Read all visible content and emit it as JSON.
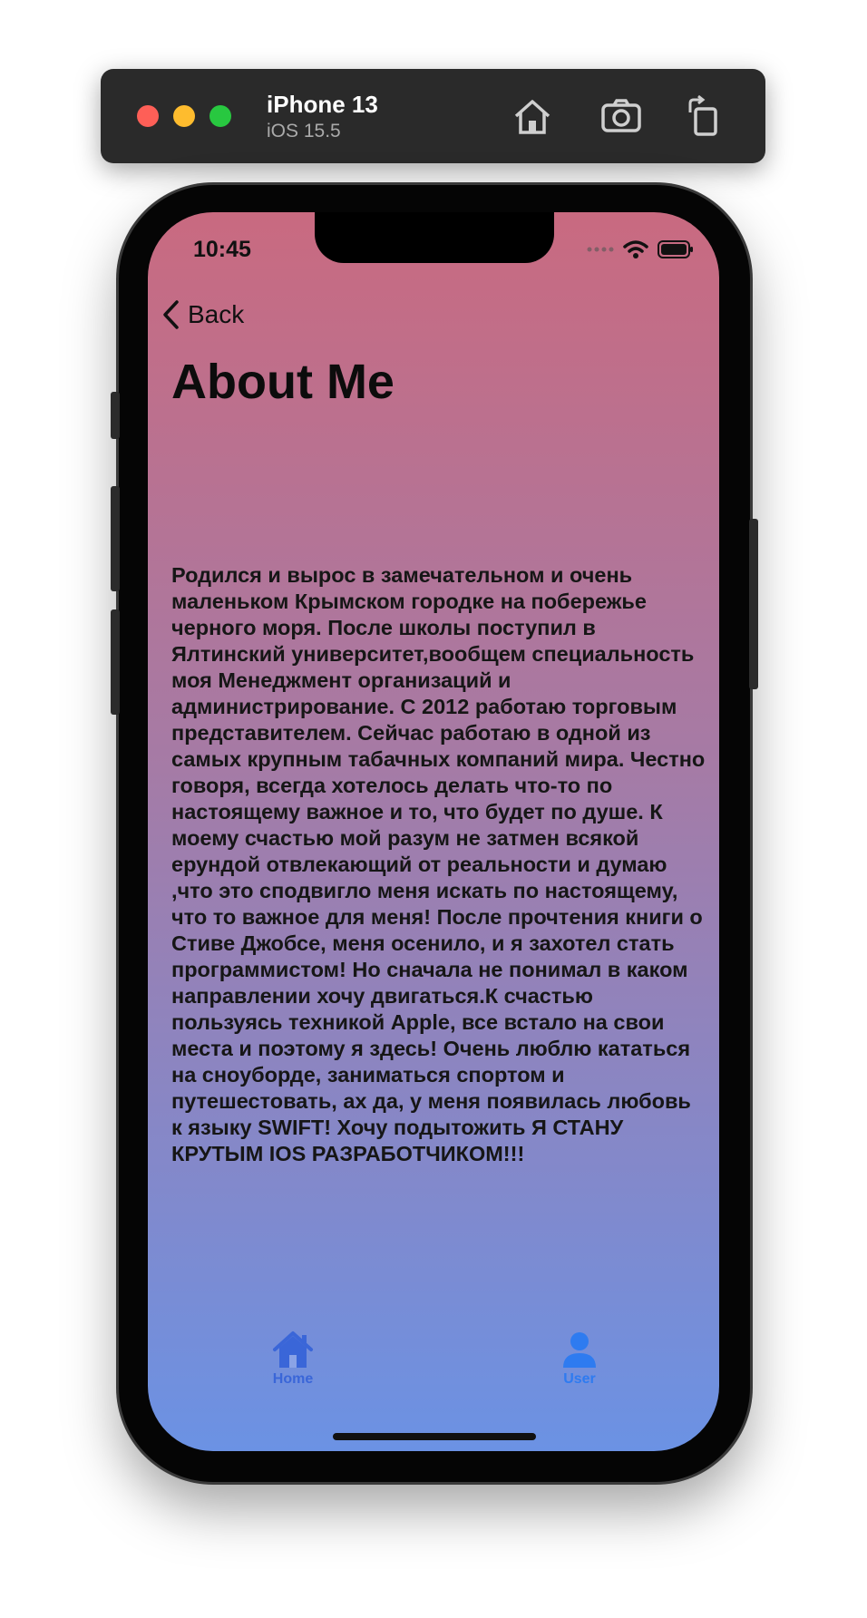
{
  "simulator": {
    "device_name": "iPhone 13",
    "os_version": "iOS 15.5",
    "buttons": [
      "home-icon",
      "screenshot-icon",
      "rotate-icon"
    ]
  },
  "status_bar": {
    "time": "10:45"
  },
  "nav": {
    "back_label": "Back"
  },
  "page": {
    "title": "About Me",
    "body": "Родился и вырос в замечательном и очень маленьком Крымском городке на побережье черного моря. После школы поступил в Ялтинский университет,вообщем специальность моя Менеджмент организаций и администрирование. С 2012 работаю торговым представителем. Сейчас работаю в одной из самых крупным табачных компаний мира. Честно говоря, всегда хотелось делать что-то по настоящему важное и то, что будет по душе. К моему счастью мой разум не затмен всякой ерундой отвлекающий от реальности и думаю ,что это сподвигло меня искать по настоящему, что то важное для меня! После прочтения книги о Стиве Джобсе, меня осенило, и я захотел стать программистом! Но сначала не понимал в каком направлении хочу двигаться.К счастью пользуясь техникой Apple, все встало на свои места и поэтому я здесь! Очень люблю кататься на сноуборде, заниматься спортом и путешестовать, ах да, у меня появилась любовь к языку SWIFT! Хочу подытожить Я СТАНУ КРУТЫМ IOS РАЗРАБОТЧИКОМ!!!"
  },
  "tabbar": {
    "home_label": "Home",
    "user_label": "User"
  },
  "colors": {
    "gradient_top": "#c96a80",
    "gradient_bottom": "#6b92e4",
    "tab_accent": "#2e7bf0"
  }
}
